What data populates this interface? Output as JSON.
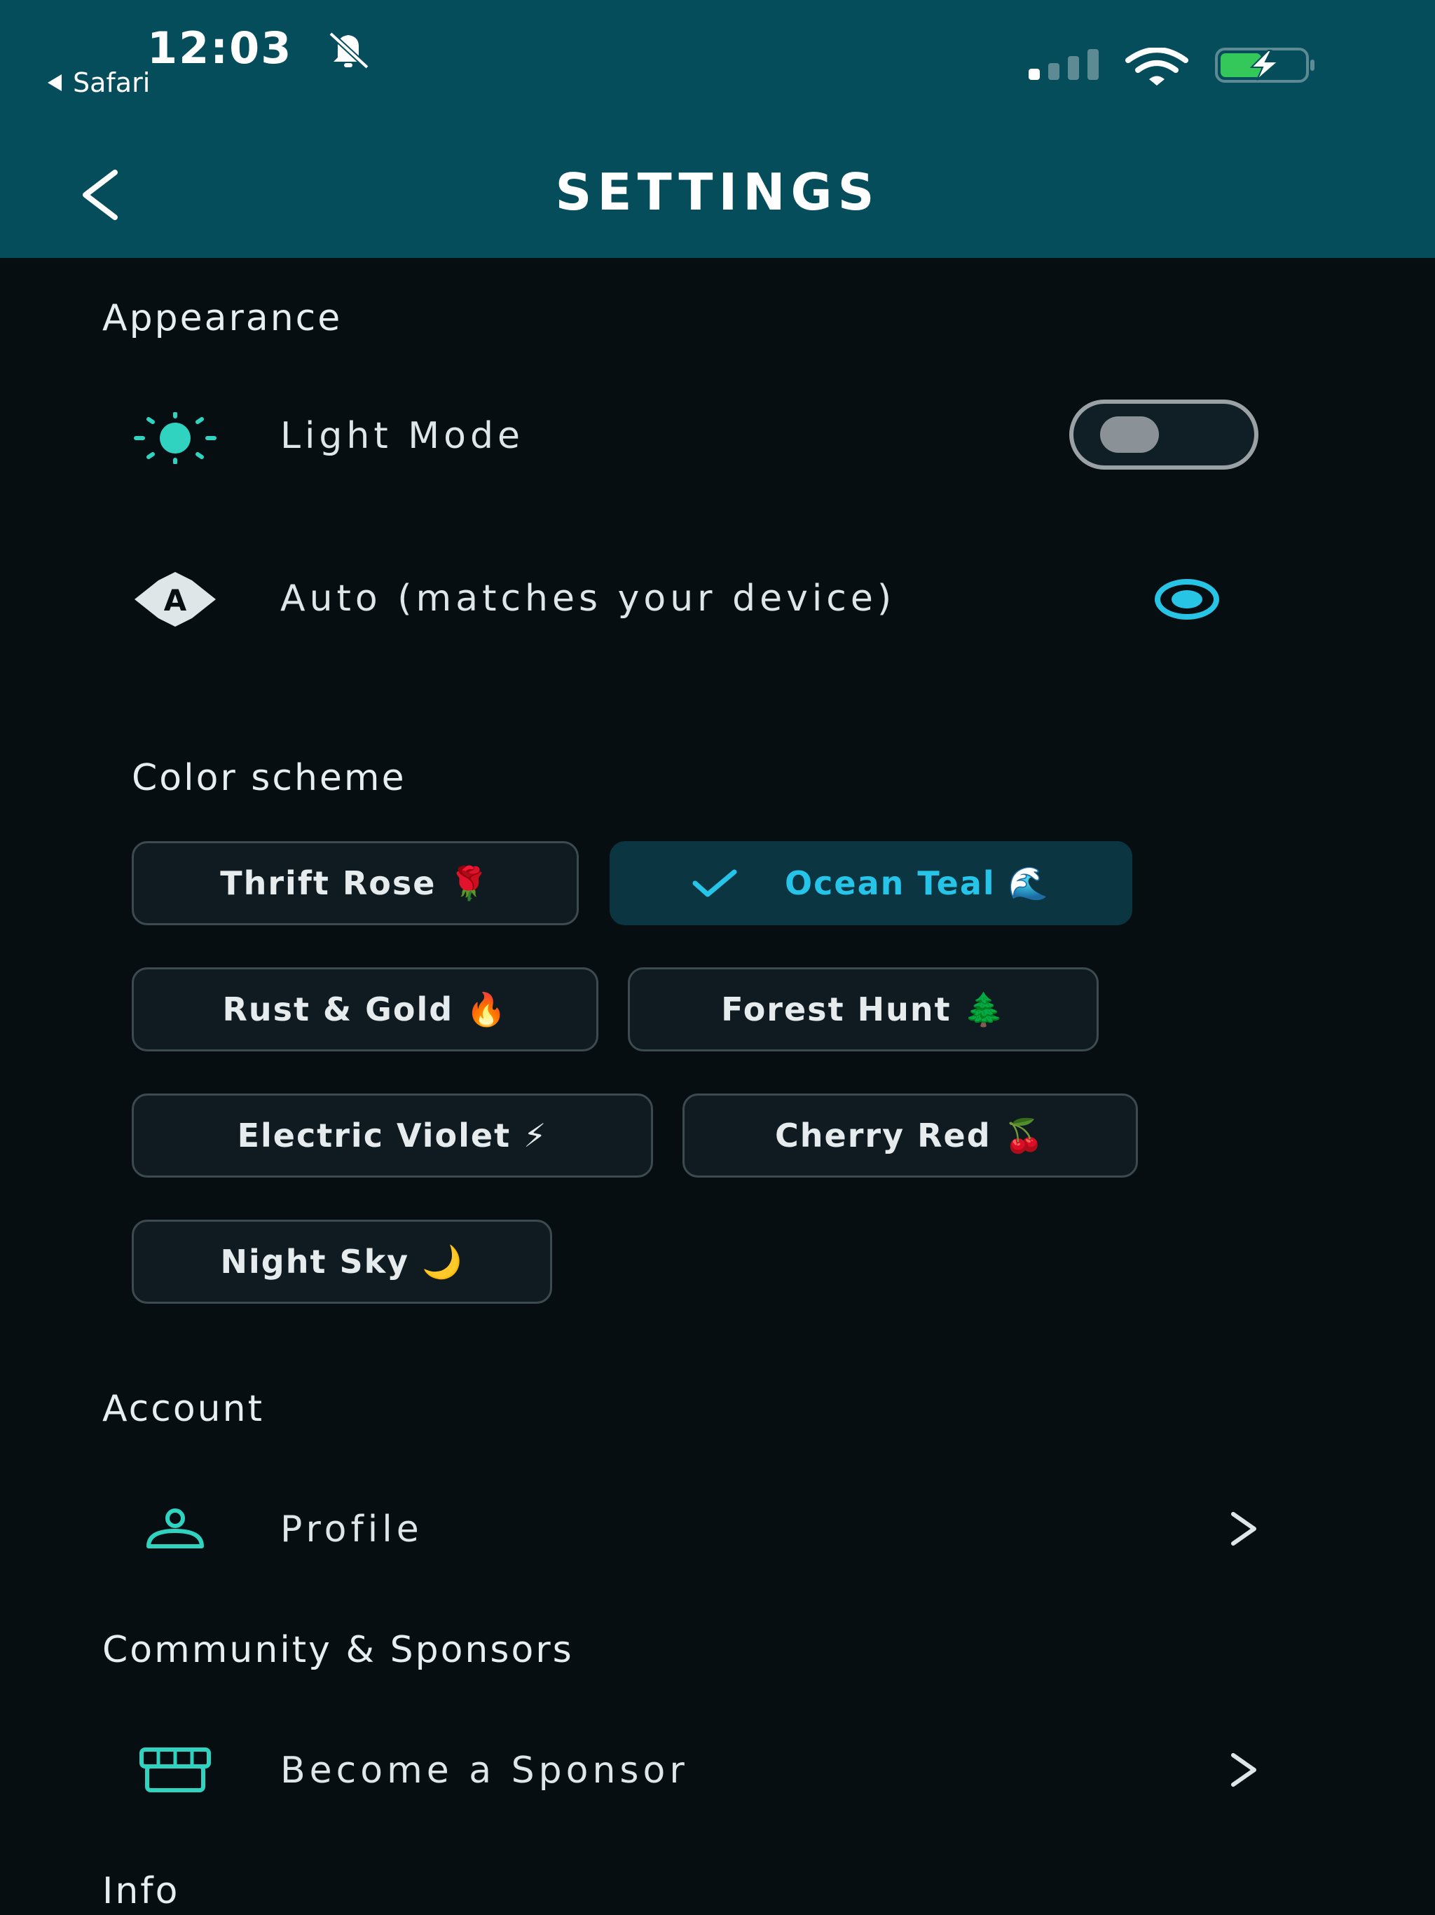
{
  "status_bar": {
    "time": "12:03",
    "back_app": "Safari"
  },
  "header": {
    "title": "SETTINGS"
  },
  "sections": {
    "appearance": "Appearance",
    "account": "Account",
    "community": "Community & Sponsors",
    "info": "Info"
  },
  "appearance": {
    "light_mode_label": "Light Mode",
    "light_mode_on": false,
    "auto_label": "Auto (matches your device)",
    "auto_selected": true,
    "color_scheme_label": "Color scheme",
    "schemes": [
      {
        "label": "Thrift Rose 🌹",
        "selected": false
      },
      {
        "label": "Ocean Teal 🌊",
        "selected": true
      },
      {
        "label": "Rust & Gold 🔥",
        "selected": false
      },
      {
        "label": "Forest Hunt 🌲",
        "selected": false
      },
      {
        "label": "Electric Violet ⚡",
        "selected": false
      },
      {
        "label": "Cherry Red 🍒",
        "selected": false
      },
      {
        "label": "Night Sky 🌙",
        "selected": false
      }
    ]
  },
  "account": {
    "profile_label": "Profile"
  },
  "community": {
    "sponsor_label": "Become a Sponsor"
  },
  "colors": {
    "header_bg": "#064d5c",
    "background": "#060e12",
    "accent": "#25c4e8",
    "icon_teal": "#2fd3c0"
  },
  "icons": {
    "bell": "bell-slash-icon",
    "signal": "cellular-signal-icon",
    "wifi": "wifi-icon",
    "battery": "battery-charging-icon",
    "back": "chevron-left-icon",
    "light": "sun-icon",
    "auto": "auto-brightness-icon",
    "check": "checkmark-icon",
    "profile": "person-icon",
    "sponsor": "storefront-icon",
    "chevron": "chevron-right-icon"
  }
}
